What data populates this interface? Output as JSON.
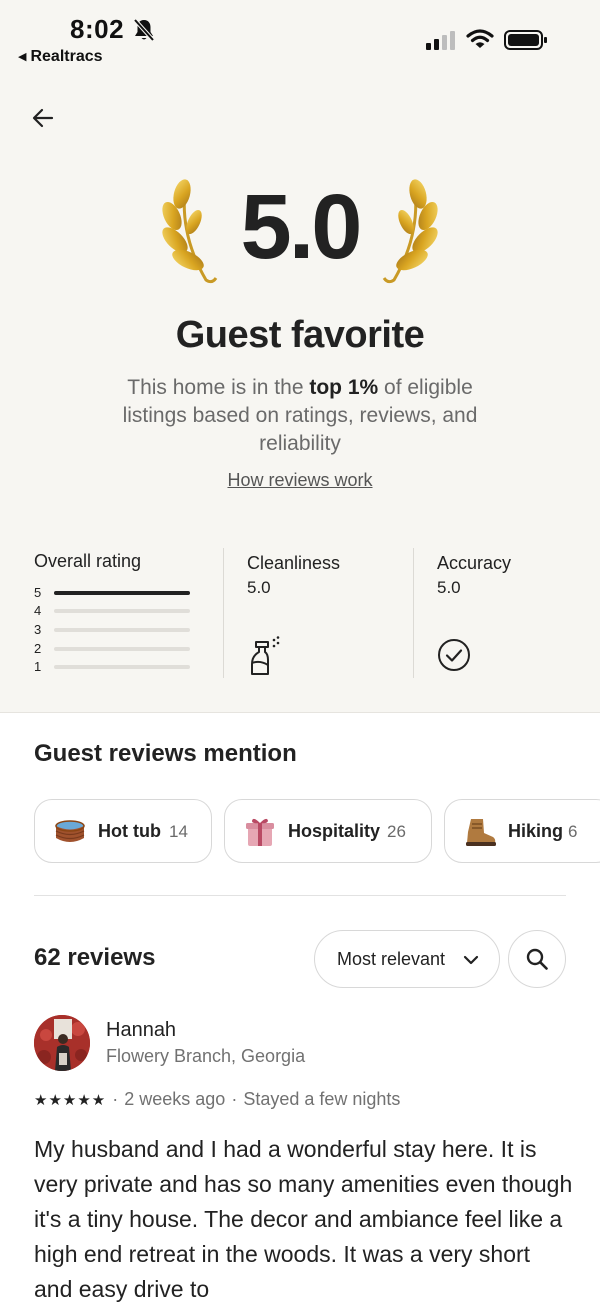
{
  "status_bar": {
    "time": "8:02",
    "back_app": "Realtracs"
  },
  "hero": {
    "score": "5.0",
    "title": "Guest favorite",
    "subtitle_pre": "This home is in the ",
    "subtitle_bold": "top 1%",
    "subtitle_post": " of eligible listings based on ratings, reviews, and reliability",
    "link": "How reviews work"
  },
  "ratings": {
    "overall_label": "Overall rating",
    "bars": [
      {
        "star": "5",
        "fraction": 1.0
      },
      {
        "star": "4",
        "fraction": 0
      },
      {
        "star": "3",
        "fraction": 0
      },
      {
        "star": "2",
        "fraction": 0
      },
      {
        "star": "1",
        "fraction": 0
      }
    ],
    "categories": [
      {
        "label": "Cleanliness",
        "value": "5.0",
        "icon": "spray-bottle-icon"
      },
      {
        "label": "Accuracy",
        "value": "5.0",
        "icon": "check-circle-icon"
      }
    ]
  },
  "mentions": {
    "title": "Guest reviews mention",
    "chips": [
      {
        "label": "Hot tub",
        "count": "14",
        "icon": "hot-tub-icon"
      },
      {
        "label": "Hospitality",
        "count": "26",
        "icon": "gift-icon"
      },
      {
        "label": "Hiking",
        "count": "6",
        "icon": "hiking-boot-icon"
      }
    ]
  },
  "reviews": {
    "count_label": "62 reviews",
    "sort_label": "Most relevant",
    "items": [
      {
        "name": "Hannah",
        "location": "Flowery Branch, Georgia",
        "stars": "★★★★★",
        "time": "2 weeks ago",
        "stay": "Stayed a few nights",
        "text": "My husband and I had a wonderful stay here. It is very private and has so many amenities even though it's a tiny house. The decor and ambiance feel like a high end retreat in the woods. It was a very short and easy drive to"
      }
    ]
  },
  "colors": {
    "background": "#f7f6f2",
    "text": "#222222",
    "muted": "#717171",
    "gold": "#d9a521"
  }
}
